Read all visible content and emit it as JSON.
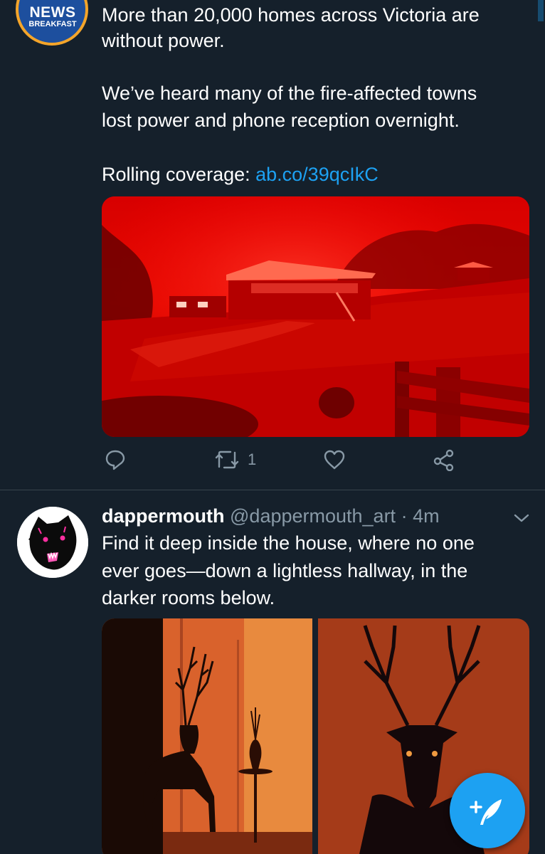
{
  "tweet1": {
    "avatar": {
      "line1": "NEWS",
      "line2": "BREAKFAST"
    },
    "lines": [
      "More than 20,000 homes across Victoria are",
      "without power.",
      "We’ve heard many of the fire-affected towns",
      "lost power and phone reception overnight."
    ],
    "coverage_label": "Rolling coverage: ",
    "coverage_link": "ab.co/39qcIkC",
    "retweet_count": "1",
    "media_icon": "bushfire-house-photo"
  },
  "tweet2": {
    "display_name": "dappermouth",
    "handle": "@dappermouth_art",
    "separator": "·",
    "time": "4m",
    "lines": [
      "Find it deep inside the house, where no one",
      "ever goes—down a lightless hallway, in the",
      "darker rooms below."
    ],
    "media_icon": "deer-illustration"
  },
  "colors": {
    "background": "#15202b",
    "accent": "#1da1f2",
    "muted": "#8899a6",
    "divider": "#38444d"
  },
  "icons": {
    "reply": "reply-icon",
    "retweet": "retweet-icon",
    "like": "heart-icon",
    "share": "share-icon",
    "menu": "chevron-down-icon",
    "compose": "compose-tweet-icon"
  }
}
